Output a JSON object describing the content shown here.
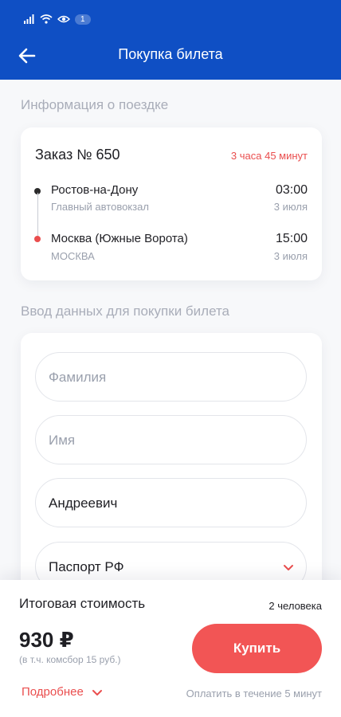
{
  "status_bar": {
    "badge": "1",
    "icons": [
      "signal-icon",
      "wifi-icon",
      "eye-icon"
    ]
  },
  "header": {
    "title": "Покупка билета",
    "back_icon": "arrow-left-icon",
    "background": "#0f4fc4"
  },
  "trip_section": {
    "title": "Информация о поездке"
  },
  "order": {
    "title": "Заказ № 650",
    "duration": "3 часа 45 минут",
    "departure": {
      "city": "Ростов-на-Дону",
      "station": "Главный автовокзал",
      "time": "03:00",
      "date": "3 июля",
      "dot_color": "#2b2b2b"
    },
    "arrival": {
      "city": "Москва (Южные Ворота)",
      "station": "МОСКВА",
      "time": "15:00",
      "date": "3 июля",
      "dot_color": "#ea4e4e"
    }
  },
  "form_section": {
    "title": "Ввод данных для покупки билета"
  },
  "form": {
    "surname_placeholder": "Фамилия",
    "name_placeholder": "Имя",
    "patronymic_value": "Андреевич",
    "document_value": "Паспорт РФ"
  },
  "summary": {
    "total_label": "Итоговая стоимость",
    "persons": "2 человека",
    "price": "930 ₽",
    "commission": "(в т.ч. комсбор 15 руб.)",
    "buy_label": "Купить",
    "details_label": "Подробнее",
    "pay_within": "Оплатить в течение 5 минут"
  },
  "colors": {
    "accent": "#f25555",
    "brand": "#0f4fc4",
    "muted": "#9aa0ad"
  }
}
